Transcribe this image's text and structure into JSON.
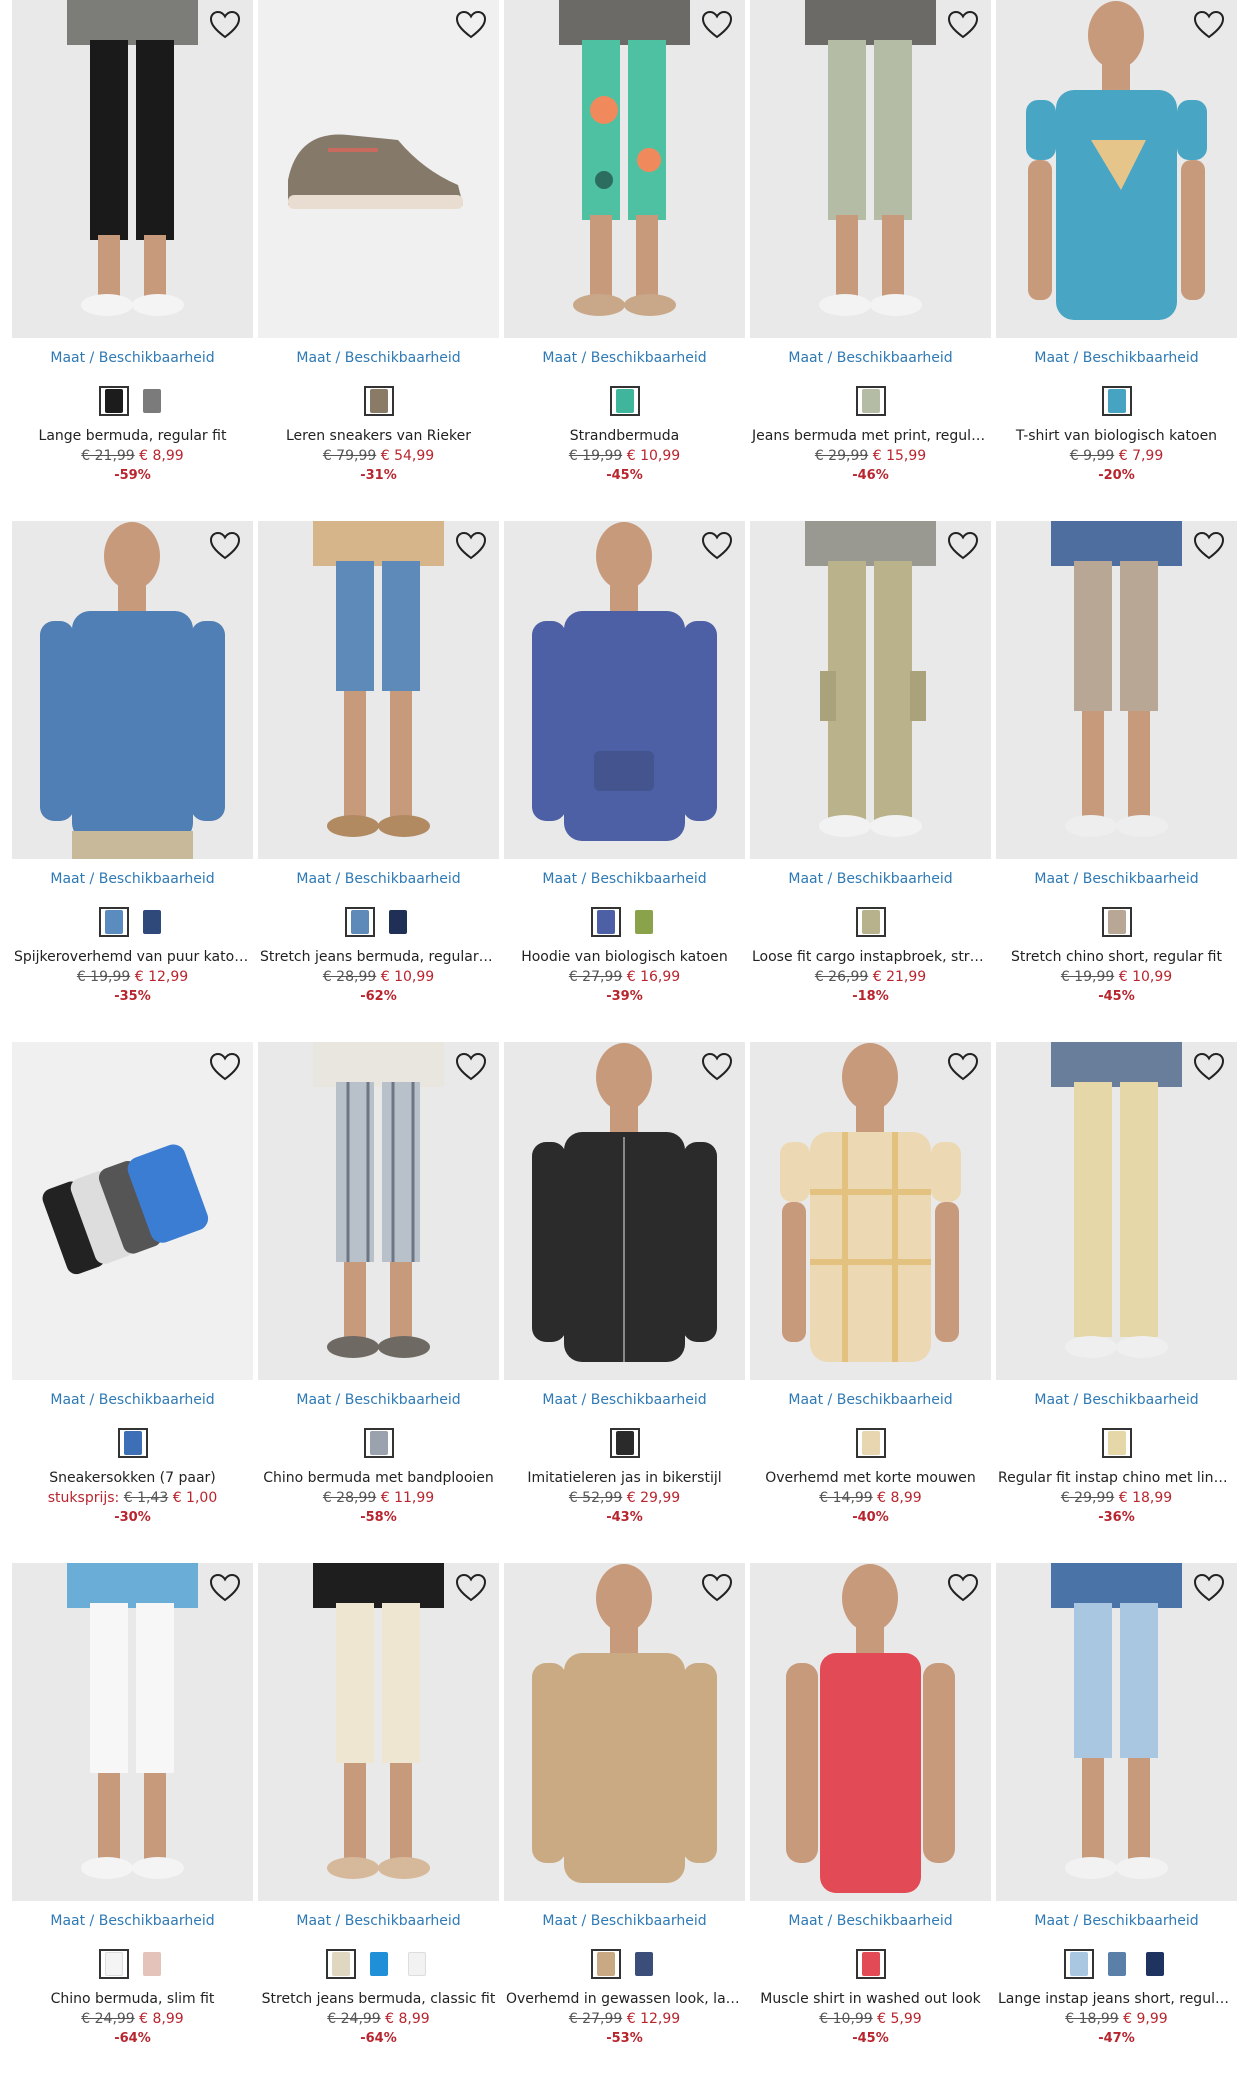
{
  "colors": {
    "link": "#2f7ab5",
    "sale": "#b8252e",
    "background": "#e8e8e8"
  },
  "availability_label": "Maat / Beschikbaarheid",
  "products": [
    {
      "name": "Lange bermuda, regular fit",
      "old_price": "€ 21,99",
      "new_price": "€ 8,99",
      "discount": "-59%",
      "bg": "#e9e9e9",
      "figure": "black-bermuda",
      "swatches": [
        "#1c1c1c",
        "#7b7b7b"
      ]
    },
    {
      "name": "Leren sneakers van Rieker",
      "old_price": "€ 79,99",
      "new_price": "€ 54,99",
      "discount": "-31%",
      "bg": "#f0f0f0",
      "figure": "sneaker",
      "swatches": [
        "#8a7b66"
      ]
    },
    {
      "name": "Strandbermuda",
      "old_price": "€ 19,99",
      "new_price": "€ 10,99",
      "discount": "-45%",
      "bg": "#e9e9e9",
      "figure": "tropical-shorts",
      "swatches": [
        "#3fb59b"
      ]
    },
    {
      "name": "Jeans bermuda met print, regular fit",
      "old_price": "€ 29,99",
      "new_price": "€ 15,99",
      "discount": "-46%",
      "bg": "#e9e9e9",
      "figure": "sage-bermuda",
      "swatches": [
        "#b4bca5"
      ]
    },
    {
      "name": "T-shirt van biologisch katoen",
      "old_price": "€ 9,99",
      "new_price": "€ 7,99",
      "discount": "-20%",
      "bg": "#e9e9e9",
      "figure": "teal-tshirt",
      "swatches": [
        "#46a3c1"
      ]
    },
    {
      "name": "Spijkeroverhemd van puur katoen, ...",
      "old_price": "€ 19,99",
      "new_price": "€ 12,99",
      "discount": "-35%",
      "bg": "#e9e9e9",
      "figure": "denim-shirt",
      "swatches": [
        "#5a8cc0",
        "#2f4a7a"
      ]
    },
    {
      "name": "Stretch jeans bermuda, regular fit",
      "old_price": "€ 28,99",
      "new_price": "€ 10,99",
      "discount": "-62%",
      "bg": "#e9e9e9",
      "figure": "denim-shorts",
      "swatches": [
        "#5d8ab8",
        "#1f2f55"
      ]
    },
    {
      "name": "Hoodie van biologisch katoen",
      "old_price": "€ 27,99",
      "new_price": "€ 16,99",
      "discount": "-39%",
      "bg": "#e9e9e9",
      "figure": "hoodie",
      "swatches": [
        "#4d5fa5",
        "#8aa34a"
      ]
    },
    {
      "name": "Loose fit cargo instapbroek, straight",
      "old_price": "€ 26,99",
      "new_price": "€ 21,99",
      "discount": "-18%",
      "bg": "#e9e9e9",
      "figure": "cargo",
      "swatches": [
        "#b7b28b"
      ]
    },
    {
      "name": "Stretch chino short, regular fit",
      "old_price": "€ 19,99",
      "new_price": "€ 10,99",
      "discount": "-45%",
      "bg": "#e9e9e9",
      "figure": "chino-short",
      "swatches": [
        "#b8a795"
      ]
    },
    {
      "name": "Sneakersokken (7 paar)",
      "unit_label": "stuksprijs:",
      "old_price": "€ 1,43",
      "new_price": "€ 1,00",
      "discount": "-30%",
      "bg": "#f0f0f0",
      "figure": "socks",
      "swatches": [
        "#3c6fb5"
      ]
    },
    {
      "name": "Chino bermuda met bandplooien",
      "old_price": "€ 28,99",
      "new_price": "€ 11,99",
      "discount": "-58%",
      "bg": "#e9e9e9",
      "figure": "striped-bermuda",
      "swatches": [
        "#9aa2ad"
      ]
    },
    {
      "name": "Imitatieleren jas in bikerstijl",
      "old_price": "€ 52,99",
      "new_price": "€ 29,99",
      "discount": "-43%",
      "bg": "#e9e9e9",
      "figure": "leather-jacket",
      "swatches": [
        "#2a2a2a"
      ]
    },
    {
      "name": "Overhemd met korte mouwen",
      "old_price": "€ 14,99",
      "new_price": "€ 8,99",
      "discount": "-40%",
      "bg": "#e9e9e9",
      "figure": "check-shirt",
      "swatches": [
        "#e8d6b0"
      ]
    },
    {
      "name": "Regular fit instap chino met linnen, ...",
      "old_price": "€ 29,99",
      "new_price": "€ 18,99",
      "discount": "-36%",
      "bg": "#e9e9e9",
      "figure": "linen-chino",
      "swatches": [
        "#e5d7a8"
      ]
    },
    {
      "name": "Chino bermuda, slim fit",
      "old_price": "€ 24,99",
      "new_price": "€ 8,99",
      "discount": "-64%",
      "bg": "#e9e9e9",
      "figure": "white-bermuda",
      "swatches": [
        "#f4f4f4",
        "#e4c3ba"
      ]
    },
    {
      "name": "Stretch jeans bermuda, classic fit",
      "old_price": "€ 24,99",
      "new_price": "€ 8,99",
      "discount": "-64%",
      "bg": "#e9e9e9",
      "figure": "cream-bermuda",
      "swatches": [
        "#e0d7c1",
        "#1f8fd8",
        "#f2f2f2"
      ]
    },
    {
      "name": "Overhemd in gewassen look, lange ...",
      "old_price": "€ 27,99",
      "new_price": "€ 12,99",
      "discount": "-53%",
      "bg": "#e9e9e9",
      "figure": "khaki-shirt",
      "swatches": [
        "#c8a984",
        "#3b4e79"
      ]
    },
    {
      "name": "Muscle shirt in washed out look",
      "old_price": "€ 10,99",
      "new_price": "€ 5,99",
      "discount": "-45%",
      "bg": "#e9e9e9",
      "figure": "tank",
      "swatches": [
        "#e24a55"
      ]
    },
    {
      "name": "Lange instap jeans short, regular fit",
      "old_price": "€ 18,99",
      "new_price": "€ 9,99",
      "discount": "-47%",
      "bg": "#e9e9e9",
      "figure": "light-denim",
      "swatches": [
        "#a9c7e0",
        "#5a7fa8",
        "#1f3360"
      ]
    }
  ]
}
